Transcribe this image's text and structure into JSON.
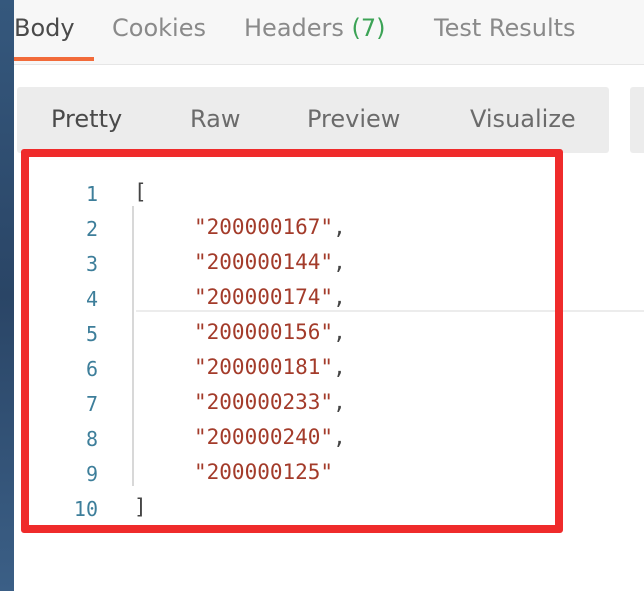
{
  "tabs": [
    {
      "label": "Body",
      "active": true
    },
    {
      "label": "Cookies",
      "active": false
    },
    {
      "label": "Headers",
      "count": "(7)",
      "active": false
    },
    {
      "label": "Test Results",
      "active": false
    }
  ],
  "view_modes": [
    "Pretty",
    "Raw",
    "Preview",
    "Visualize"
  ],
  "active_view": "Pretty",
  "code_lines": [
    {
      "no": "1",
      "text": "["
    },
    {
      "no": "2",
      "value": "\"200000167\"",
      "sep": ","
    },
    {
      "no": "3",
      "value": "\"200000144\"",
      "sep": ","
    },
    {
      "no": "4",
      "value": "\"200000174\"",
      "sep": ","
    },
    {
      "no": "5",
      "value": "\"200000156\"",
      "sep": ","
    },
    {
      "no": "6",
      "value": "\"200000181\"",
      "sep": ","
    },
    {
      "no": "7",
      "value": "\"200000233\"",
      "sep": ","
    },
    {
      "no": "8",
      "value": "\"200000240\"",
      "sep": ","
    },
    {
      "no": "9",
      "value": "\"200000125\"",
      "sep": ""
    },
    {
      "no": "10",
      "text": "]"
    }
  ],
  "colors": {
    "accent_underline": "#f26b3a",
    "highlight_border": "#ef2b2b",
    "string": "#a33b2a",
    "line_number": "#3d7e9a",
    "count": "#3ca356"
  }
}
